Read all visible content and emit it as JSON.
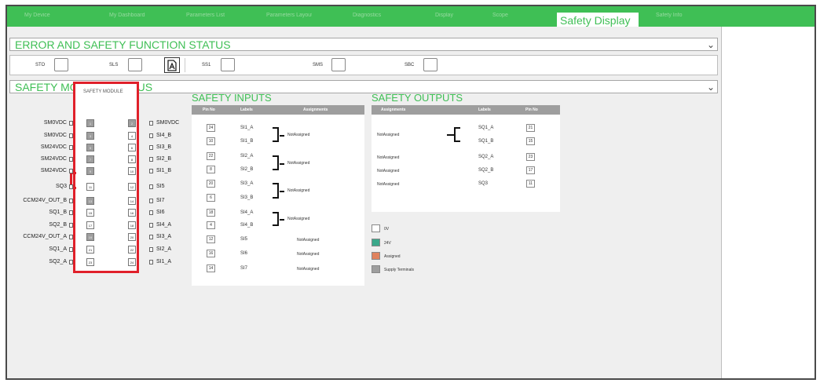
{
  "tabs": [
    "My Device",
    "My Dashboard",
    "Parameters List",
    "Parameters Layout",
    "Diagnostics",
    "Display",
    "Scope",
    "Safety Display",
    "Safety Info"
  ],
  "active_tab": "Safety Display",
  "colors": {
    "brand": "#3fbf55",
    "highlight": "#e0202a",
    "supply": "#9e9e9e",
    "v24": "#3aa88a",
    "assigned": "#e0825e",
    "v0": "#ffffff"
  },
  "error_section": {
    "title": "ERROR AND SAFETY FUNCTION STATUS",
    "expand_icon": "chevron-down-icon",
    "functions": [
      "STO",
      "SLS",
      "SS1",
      "SMS",
      "SBC"
    ]
  },
  "module_section": {
    "title": "SAFETY MODULE STATUS",
    "expand_icon": "chevron-down-icon"
  },
  "safety_module": {
    "title": "SAFETY MODULE",
    "left_signals": [
      "SM0VDC",
      "SM0VDC",
      "SM24VDC",
      "SM24VDC",
      "SM24VDC",
      "SQ3",
      "CCM24V_OUT_B",
      "SQ1_B",
      "SQ2_B",
      "CCM24V_OUT_A",
      "SQ1_A",
      "SQ2_A"
    ],
    "left_pins": [
      "1",
      "3",
      "5",
      "7",
      "9",
      "11",
      "13",
      "15",
      "17",
      "19",
      "21",
      "23"
    ],
    "right_pins": [
      "2",
      "4",
      "6",
      "8",
      "10",
      "12",
      "14",
      "16",
      "18",
      "20",
      "22",
      "24"
    ],
    "right_signals": [
      "SM0VDC",
      "SI4_B",
      "SI3_B",
      "SI2_B",
      "SI1_B",
      "SI5",
      "SI7",
      "SI6",
      "SI4_A",
      "SI3_A",
      "SI2_A",
      "SI1_A"
    ]
  },
  "safety_inputs": {
    "title": "SAFETY INPUTS",
    "headers": [
      "Pin No",
      "Labels",
      "Assignments"
    ],
    "rows": [
      {
        "pin": "24",
        "label": "SI1_A"
      },
      {
        "pin": "10",
        "label": "SI1_B"
      },
      {
        "pin": "22",
        "label": "SI2_A"
      },
      {
        "pin": "8",
        "label": "SI2_B"
      },
      {
        "pin": "20",
        "label": "SI3_A"
      },
      {
        "pin": "6",
        "label": "SI3_B"
      },
      {
        "pin": "18",
        "label": "SI4_A"
      },
      {
        "pin": "4",
        "label": "SI4_B"
      },
      {
        "pin": "12",
        "label": "SI5"
      },
      {
        "pin": "16",
        "label": "SI6"
      },
      {
        "pin": "14",
        "label": "SI7"
      }
    ],
    "pair_assignments": [
      "NotAssigned",
      "NotAssigned",
      "NotAssigned",
      "NotAssigned"
    ],
    "single_assignments": [
      "NotAssigned",
      "NotAssigned",
      "NotAssigned"
    ]
  },
  "safety_outputs": {
    "title": "SAFETY OUTPUTS",
    "headers": [
      "Assignments",
      "Labels",
      "Pin No"
    ],
    "rows": [
      {
        "assignment": "NotAssigned",
        "label": "SQ1_A",
        "pin": "21"
      },
      {
        "assignment": "",
        "label": "SQ1_B",
        "pin": "15"
      },
      {
        "assignment": "NotAssigned",
        "label": "SQ2_A",
        "pin": "23"
      },
      {
        "assignment": "NotAssigned",
        "label": "SQ2_B",
        "pin": "17"
      },
      {
        "assignment": "NotAssigned",
        "label": "SQ3",
        "pin": "11"
      }
    ]
  },
  "legend": [
    {
      "label": "0V",
      "color": "#ffffff"
    },
    {
      "label": "24V",
      "color": "#3aa88a"
    },
    {
      "label": "Assigned",
      "color": "#e0825e"
    },
    {
      "label": "Supply Terminals",
      "color": "#9e9e9e"
    }
  ]
}
